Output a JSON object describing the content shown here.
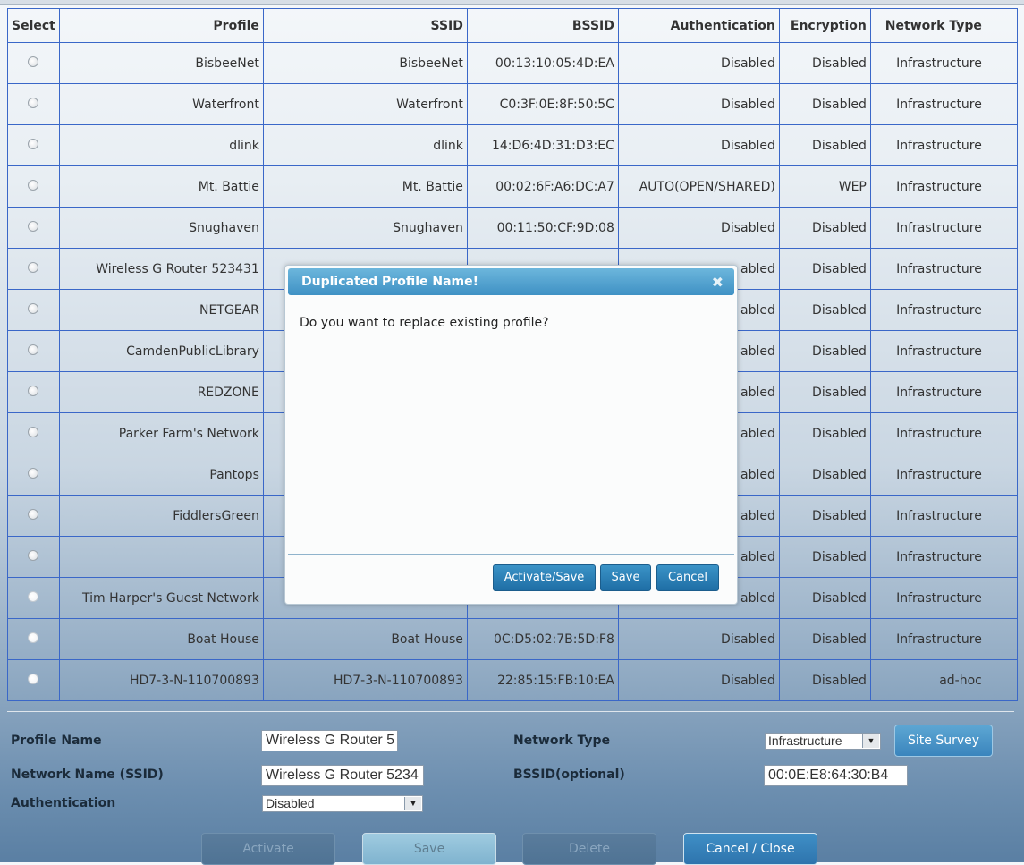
{
  "table": {
    "columns": [
      "Select",
      "Profile",
      "SSID",
      "BSSID",
      "Authentication",
      "Encryption",
      "Network Type"
    ],
    "rows": [
      {
        "profile": "BisbeeNet",
        "ssid": "BisbeeNet",
        "bssid": "00:13:10:05:4D:EA",
        "auth": "Disabled",
        "enc": "Disabled",
        "type": "Infrastructure"
      },
      {
        "profile": "Waterfront",
        "ssid": "Waterfront",
        "bssid": "C0:3F:0E:8F:50:5C",
        "auth": "Disabled",
        "enc": "Disabled",
        "type": "Infrastructure"
      },
      {
        "profile": "dlink",
        "ssid": "dlink",
        "bssid": "14:D6:4D:31:D3:EC",
        "auth": "Disabled",
        "enc": "Disabled",
        "type": "Infrastructure"
      },
      {
        "profile": "Mt. Battie",
        "ssid": "Mt. Battie",
        "bssid": "00:02:6F:A6:DC:A7",
        "auth": "AUTO(OPEN/SHARED)",
        "enc": "WEP",
        "type": "Infrastructure"
      },
      {
        "profile": "Snughaven",
        "ssid": "Snughaven",
        "bssid": "00:11:50:CF:9D:08",
        "auth": "Disabled",
        "enc": "Disabled",
        "type": "Infrastructure"
      },
      {
        "profile": "Wireless G Router 523431",
        "ssid": "",
        "bssid": "",
        "auth": "abled",
        "enc": "Disabled",
        "type": "Infrastructure"
      },
      {
        "profile": "NETGEAR",
        "ssid": "",
        "bssid": "",
        "auth": "abled",
        "enc": "Disabled",
        "type": "Infrastructure"
      },
      {
        "profile": "CamdenPublicLibrary",
        "ssid": "",
        "bssid": "",
        "auth": "abled",
        "enc": "Disabled",
        "type": "Infrastructure"
      },
      {
        "profile": "REDZONE",
        "ssid": "",
        "bssid": "",
        "auth": "abled",
        "enc": "Disabled",
        "type": "Infrastructure"
      },
      {
        "profile": "Parker Farm's Network",
        "ssid": "",
        "bssid": "",
        "auth": "abled",
        "enc": "Disabled",
        "type": "Infrastructure"
      },
      {
        "profile": "Pantops",
        "ssid": "",
        "bssid": "",
        "auth": "abled",
        "enc": "Disabled",
        "type": "Infrastructure"
      },
      {
        "profile": "FiddlersGreen",
        "ssid": "",
        "bssid": "",
        "auth": "abled",
        "enc": "Disabled",
        "type": "Infrastructure"
      },
      {
        "profile": "",
        "ssid": "",
        "bssid": "",
        "auth": "abled",
        "enc": "Disabled",
        "type": "Infrastructure"
      },
      {
        "profile": "Tim Harper's Guest Network",
        "ssid": "",
        "bssid": "",
        "auth": "abled",
        "enc": "Disabled",
        "type": "Infrastructure"
      },
      {
        "profile": "Boat House",
        "ssid": "Boat House",
        "bssid": "0C:D5:02:7B:5D:F8",
        "auth": "Disabled",
        "enc": "Disabled",
        "type": "Infrastructure"
      },
      {
        "profile": "HD7-3-N-110700893",
        "ssid": "HD7-3-N-110700893",
        "bssid": "22:85:15:FB:10:EA",
        "auth": "Disabled",
        "enc": "Disabled",
        "type": "ad-hoc"
      }
    ]
  },
  "form": {
    "profile_name_label": "Profile Name",
    "profile_name_value": "Wireless G Router 5",
    "ssid_label": "Network Name (SSID)",
    "ssid_value": "Wireless G Router 5234",
    "auth_label": "Authentication",
    "auth_value": "Disabled",
    "network_type_label": "Network Type",
    "network_type_value": "Infrastructure",
    "bssid_label": "BSSID(optional)",
    "bssid_value": "00:0E:E8:64:30:B4",
    "site_survey_label": "Site Survey"
  },
  "buttons": {
    "activate": "Activate",
    "save": "Save",
    "delete": "Delete",
    "cancel_close": "Cancel / Close"
  },
  "dialog": {
    "title": "Duplicated Profile Name!",
    "close_glyph": "✖",
    "message": "Do you want to replace existing profile?",
    "activate_save": "Activate/Save",
    "save": "Save",
    "cancel": "Cancel"
  },
  "icons": {
    "select_arrow": "▼"
  },
  "colors": {
    "grid_line": "#3a67c8",
    "dialog_title": "#4a9ccc",
    "button_blue": "#2b7db5"
  }
}
